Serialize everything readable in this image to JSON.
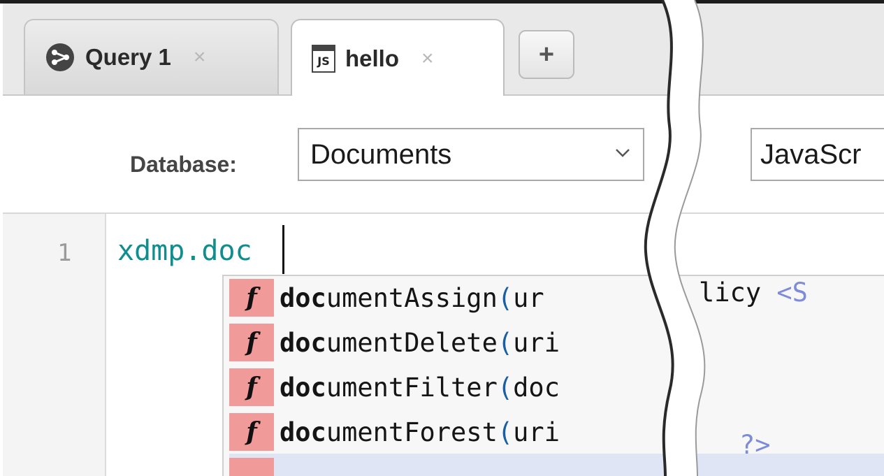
{
  "tabs": [
    {
      "label": "Query 1",
      "icon": "query-icon",
      "close": "×"
    },
    {
      "label": "hello",
      "icon": "js-file-icon",
      "icon_text": "JS",
      "close": "×"
    }
  ],
  "add_tab": {
    "label": "+"
  },
  "toolbar": {
    "database_label": "Database:",
    "database_value": "Documents",
    "language_value": "JavaScr"
  },
  "editor": {
    "line_number": "1",
    "code": "xdmp.doc"
  },
  "autocomplete": {
    "items": [
      {
        "icon": "f",
        "match": "doc",
        "rest": "umentAssign",
        "paren": "(",
        "args": "ur"
      },
      {
        "icon": "f",
        "match": "doc",
        "rest": "umentDelete",
        "paren": "(",
        "args": "uri"
      },
      {
        "icon": "f",
        "match": "doc",
        "rest": "umentFilter",
        "paren": "(",
        "args": "doc"
      },
      {
        "icon": "f",
        "match": "doc",
        "rest": "umentForest",
        "paren": "(",
        "args": "uri"
      }
    ],
    "right_fragment_1": "licy ",
    "right_fragment_1_type": "<S",
    "right_fragment_4": "?>"
  },
  "colors": {
    "code": "#108e8e",
    "function_icon_bg": "#f19a9a",
    "paren": "#1b5fa3",
    "selected_row": "#dfe5f4",
    "tab_close": "#b7b7b7"
  }
}
